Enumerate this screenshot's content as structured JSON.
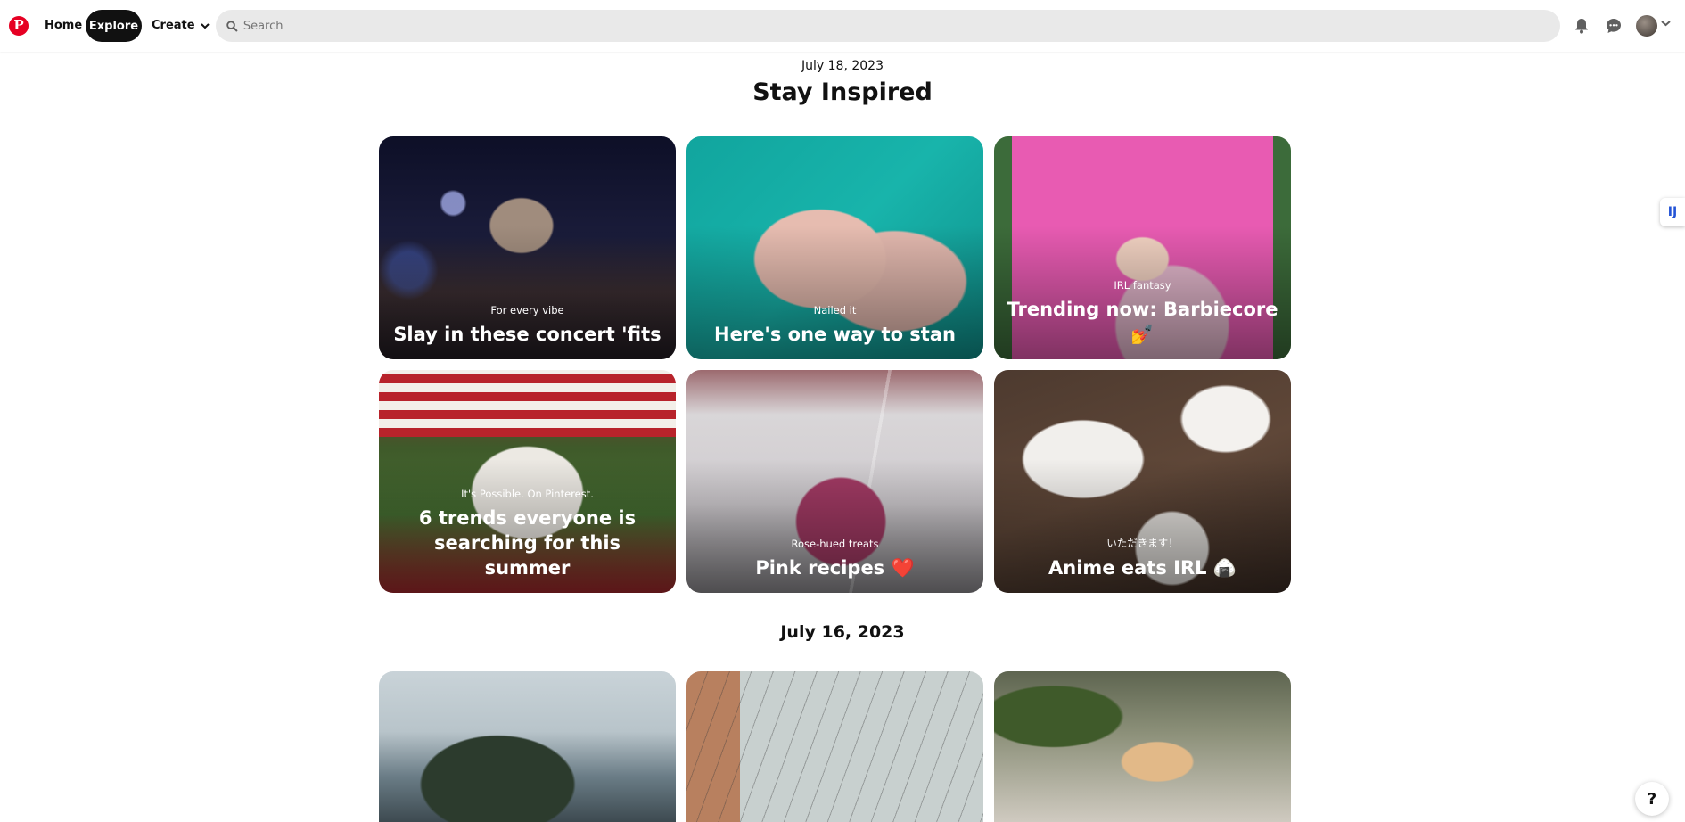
{
  "header": {
    "logo": "P",
    "nav": {
      "home": "Home",
      "explore": "Explore",
      "create": "Create"
    },
    "search": {
      "placeholder": "Search",
      "value": ""
    },
    "icons": [
      "bell-icon",
      "chat-icon",
      "avatar",
      "chevron-down-icon"
    ]
  },
  "sections": [
    {
      "date": "July 18, 2023",
      "title": "Stay Inspired",
      "cards": [
        {
          "sub": "For every vibe",
          "main": "Slay in these concert 'fits"
        },
        {
          "sub": "Nailed it",
          "main": "Here's one way to stan"
        },
        {
          "sub": "IRL fantasy",
          "main": "Trending now: Barbiecore 💅"
        },
        {
          "sub": "It's Possible. On Pinterest.",
          "main": "6 trends everyone is searching for this summer"
        },
        {
          "sub": "Rose-hued treats",
          "main": "Pink recipes ❤️"
        },
        {
          "sub": "いただきます！",
          "main": "Anime eats IRL 🍙"
        }
      ]
    },
    {
      "date": "July 16, 2023",
      "cards": [
        {
          "sub": "",
          "main": ""
        },
        {
          "sub": "",
          "main": ""
        },
        {
          "sub": "",
          "main": ""
        }
      ]
    }
  ],
  "side_tab": "IJ",
  "help": "?",
  "colors": {
    "brand": "#e60023",
    "search_bg": "#e9e9e9",
    "explore_bg": "#111111"
  }
}
